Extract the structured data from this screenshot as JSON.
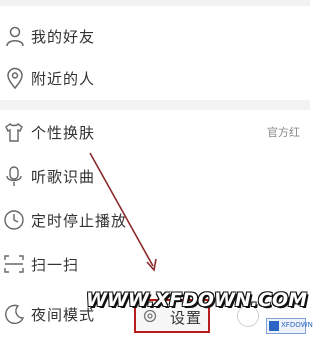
{
  "menu": {
    "group1": [
      {
        "label": "我的好友",
        "icon": "person-icon"
      },
      {
        "label": "附近的人",
        "icon": "location-pin-icon"
      }
    ],
    "group2": [
      {
        "label": "个性换肤",
        "icon": "tshirt-icon",
        "right_text": "官方红"
      },
      {
        "label": "听歌识曲",
        "icon": "microphone-icon"
      },
      {
        "label": "定时停止播放",
        "icon": "clock-icon"
      },
      {
        "label": "扫一扫",
        "icon": "scan-icon"
      },
      {
        "label": "夜间模式",
        "icon": "moon-icon"
      }
    ]
  },
  "footer": {
    "settings_label": "设置",
    "settings_icon": "gear-icon",
    "exit_icon": "power-icon"
  },
  "watermark": {
    "text": "WWW.XFDOWN.COM",
    "logo_text": "XFDOWN"
  },
  "annotation": {
    "arrow_color": "#8b2a2a",
    "highlight_color": "#b81c1c"
  }
}
